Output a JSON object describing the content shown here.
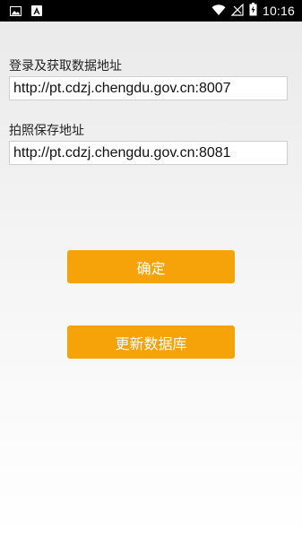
{
  "status_bar": {
    "time": "10:16",
    "left_icons": [
      "image-icon",
      "app-a-icon"
    ],
    "right_icons": [
      "wifi-icon",
      "signal-icon",
      "battery-icon"
    ]
  },
  "form": {
    "login_label": "登录及获取数据地址",
    "login_value": "http://pt.cdzj.chengdu.gov.cn:8007",
    "photo_label": "拍照保存地址",
    "photo_value": "http://pt.cdzj.chengdu.gov.cn:8081"
  },
  "buttons": {
    "confirm": "确定",
    "update_db": "更新数据库"
  },
  "colors": {
    "accent": "#f6a30a",
    "status_bar": "#000000"
  }
}
